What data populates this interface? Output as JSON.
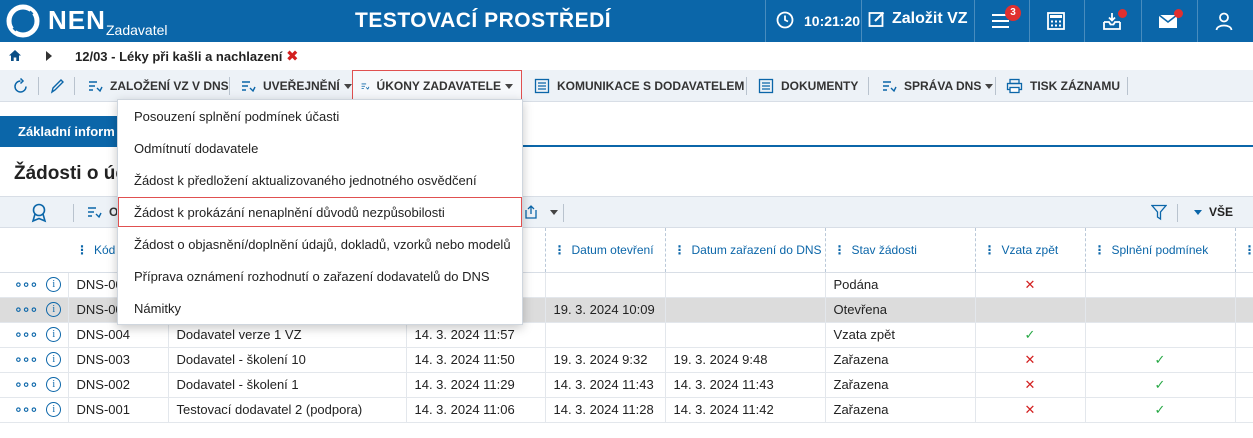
{
  "header": {
    "brand": "NEN",
    "brand_sub": "Zadavatel",
    "env_title": "TESTOVACÍ PROSTŘEDÍ",
    "time": "10:21:20",
    "new_vz_label": "Založit VZ",
    "notifications_count": "3",
    "accent_color": "#0b66a9",
    "icons": [
      "clock-icon",
      "edit-icon",
      "menu-icon",
      "calculator-icon",
      "inbox-icon",
      "mail-icon",
      "user-icon"
    ]
  },
  "breadcrumb": {
    "title": "12/03 - Léky při kašli a nachlazení"
  },
  "toolbar": {
    "items": [
      {
        "label": "ZALOŽENÍ VZ V DNS",
        "dropdown": false
      },
      {
        "label": "UVEŘEJNĚNÍ",
        "dropdown": true
      },
      {
        "label": "ÚKONY ZADAVATELE",
        "dropdown": true
      },
      {
        "label": "KOMUNIKACE S DODAVATELEM",
        "dropdown": false
      },
      {
        "label": "DOKUMENTY",
        "dropdown": false
      },
      {
        "label": "SPRÁVA DNS",
        "dropdown": true
      },
      {
        "label": "TISK ZÁZNAMU",
        "dropdown": false
      }
    ]
  },
  "tab": {
    "label": "Základní inform"
  },
  "section": {
    "title": "Žádosti o úča"
  },
  "grid_toolbar": {
    "partial_label": "O",
    "filter_value": "VŠE"
  },
  "dropdown_menu": {
    "items": [
      "Posouzení splnění podmínek účasti",
      "Odmítnutí dodavatele",
      "Žádost k předložení aktualizovaného jednotného osvědčení",
      "Žádost k prokázání nenaplnění důvodů nezpůsobilosti",
      "Žádost o objasnění/doplnění údajů, dokladů, vzorků nebo modelů",
      "Příprava oznámení rozhodnutí o zařazení dodavatelů do DNS",
      "Námitky"
    ],
    "highlighted_index": 3
  },
  "table": {
    "columns": [
      "Kód",
      "",
      "",
      "Datum otevření",
      "Datum zařazení do DNS",
      "Stav žádosti",
      "Vzata zpět",
      "Splnění podmínek"
    ],
    "rows": [
      {
        "code": "DNS-00",
        "supplier": "",
        "submitted": "",
        "opened": "",
        "included": "",
        "state": "Podána",
        "withdrawn": "x",
        "conditions": ""
      },
      {
        "code": "DNS-00",
        "supplier": "",
        "submitted": "",
        "opened": "19. 3. 2024 10:09",
        "included": "",
        "state": "Otevřena",
        "withdrawn": "",
        "conditions": "",
        "selected": true
      },
      {
        "code": "DNS-004",
        "supplier": "Dodavatel verze 1 VZ",
        "submitted": "14. 3. 2024 11:57",
        "opened": "",
        "included": "",
        "state": "Vzata zpět",
        "withdrawn": "ok",
        "conditions": ""
      },
      {
        "code": "DNS-003",
        "supplier": "Dodavatel - školení 10",
        "submitted": "14. 3. 2024 11:50",
        "opened": "19. 3. 2024 9:32",
        "included": "19. 3. 2024 9:48",
        "state": "Zařazena",
        "withdrawn": "x",
        "conditions": "ok"
      },
      {
        "code": "DNS-002",
        "supplier": "Dodavatel - školení 1",
        "submitted": "14. 3. 2024 11:29",
        "opened": "14. 3. 2024 11:43",
        "included": "14. 3. 2024 11:43",
        "state": "Zařazena",
        "withdrawn": "x",
        "conditions": "ok"
      },
      {
        "code": "DNS-001",
        "supplier": "Testovací dodavatel 2 (podpora)",
        "submitted": "14. 3. 2024 11:06",
        "opened": "14. 3. 2024 11:28",
        "included": "14. 3. 2024 11:42",
        "state": "Zařazena",
        "withdrawn": "x",
        "conditions": "ok"
      }
    ]
  }
}
